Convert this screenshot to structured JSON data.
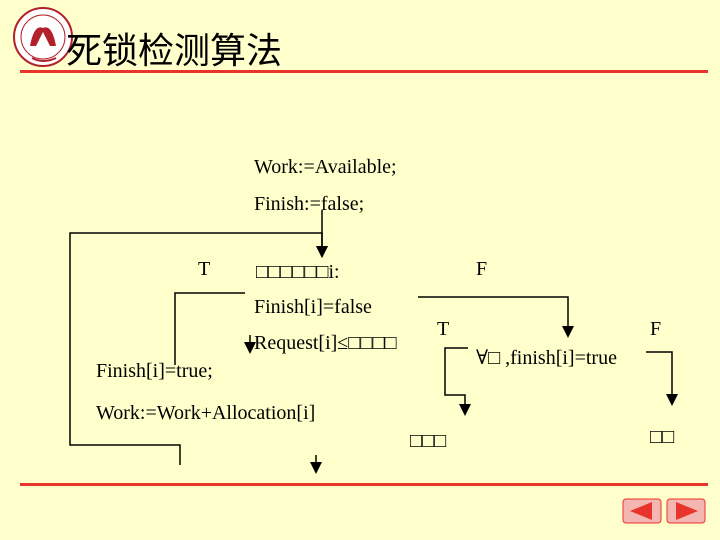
{
  "title": "死锁检测算法",
  "flow": {
    "init_work": "Work:=Available;",
    "init_finish": "Finish:=false;",
    "label_t_left": "T",
    "find_line": "□□□□□□i:",
    "label_f_top": "F",
    "cond_finish": "Finish[i]=false",
    "label_t_mid": "T",
    "cond_request": "Request[i]≤□□□□",
    "label_f_right": "F",
    "check_all": "∀□ ,finish[i]=true",
    "set_finish": "Finish[i]=true;",
    "update_work": "Work:=Work+Allocation[i]",
    "result_yes": "□□□",
    "result_no": "□□"
  },
  "colors": {
    "background": "#FFFFCC",
    "rule": "#E8342A",
    "nav": "#E8342A"
  }
}
